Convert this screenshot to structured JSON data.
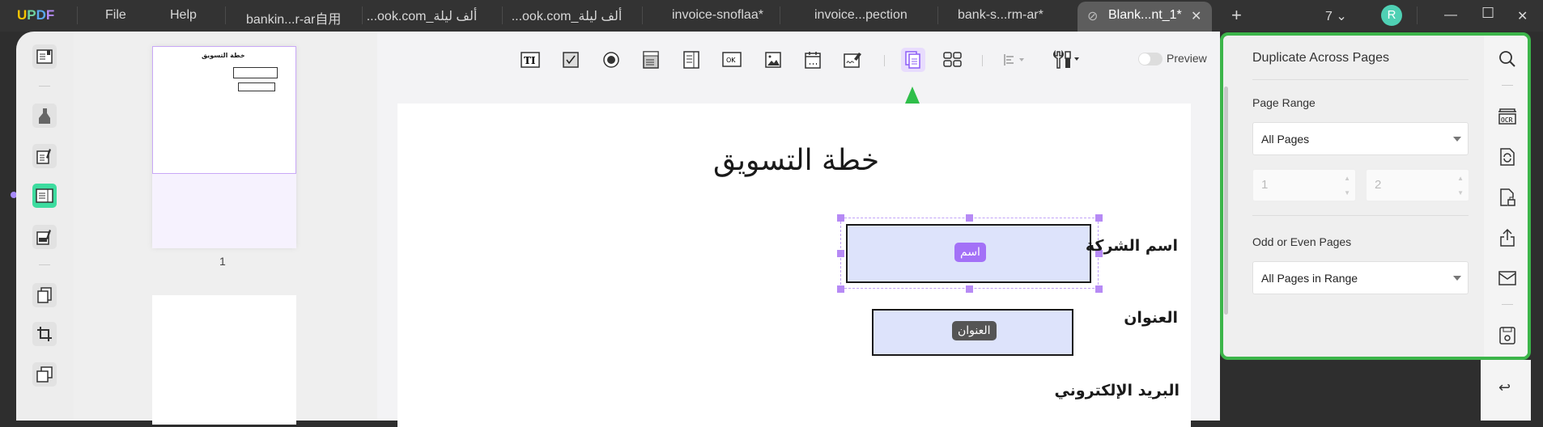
{
  "app": {
    "logo": "UPDF",
    "menu": [
      "File",
      "Help"
    ]
  },
  "tabs": [
    "bankin...r-ar自用",
    "...ook.com_ألف ليلة",
    "...ook.com_ألف ليلة",
    "invoice-snoflaa*",
    "invoice...pection",
    "bank-s...rm-ar*"
  ],
  "active_tab": "Blank...nt_1*",
  "window": {
    "count": "7",
    "avatar": "R"
  },
  "toolbar": {
    "preview_label": "Preview",
    "preview_on": false,
    "active_tool": "duplicate-across-pages"
  },
  "thumbnails": {
    "page_number": "1"
  },
  "document": {
    "title": "خطة التسويق",
    "fields": [
      {
        "label": "اسم الشركة",
        "chip": "اسم"
      },
      {
        "label": "العنوان",
        "chip": "العنوان"
      },
      {
        "label": "البريد الإلكتروني"
      }
    ]
  },
  "panel": {
    "title": "Duplicate Across Pages",
    "page_range_label": "Page Range",
    "page_range_value": "All Pages",
    "from": "1",
    "to": "2",
    "odd_even_label": "Odd or Even Pages",
    "odd_even_value": "All Pages in Range"
  },
  "colors": {
    "accent": "#b68af5",
    "highlight": "#3cb54a",
    "field": "#dde3fb",
    "active_rail": "#3ddc9f"
  }
}
